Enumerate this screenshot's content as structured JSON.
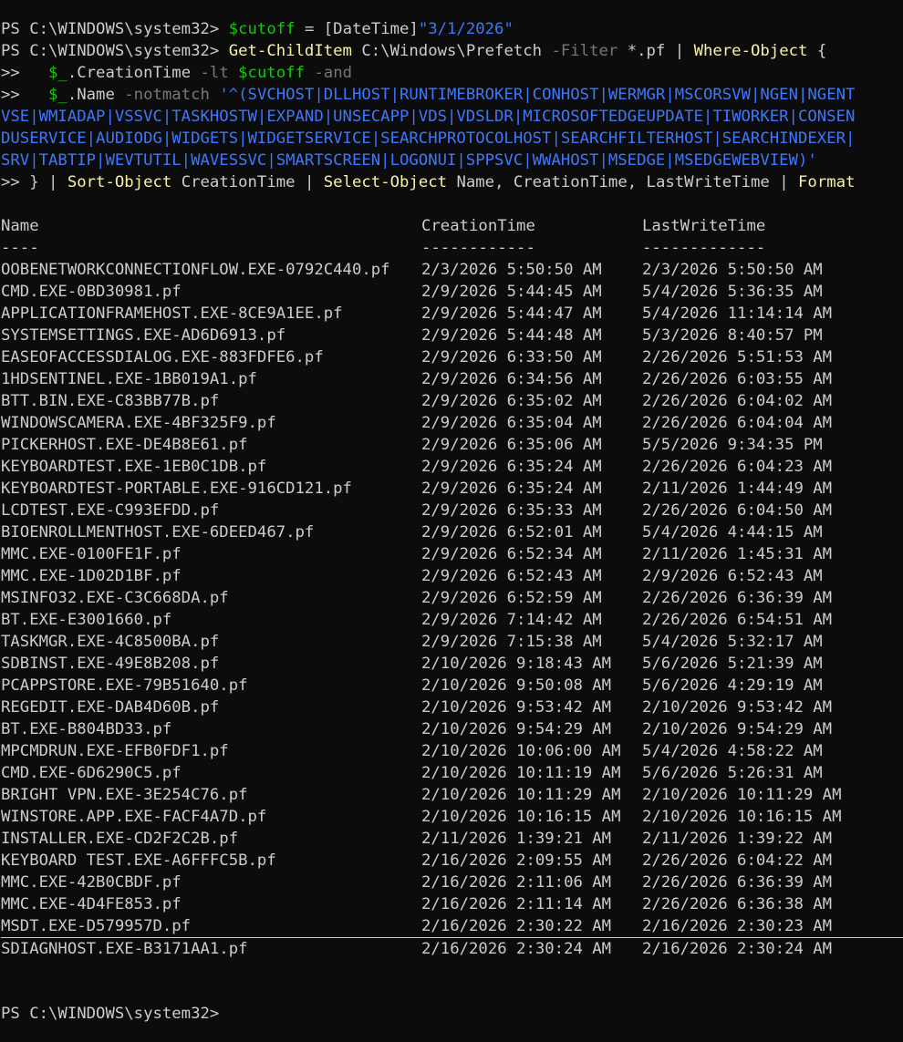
{
  "prompt": "PS C:\\WINDOWS\\system32>",
  "cont": ">>",
  "cmd1": {
    "var": "$cutoff",
    "eq": "=",
    "type": "[DateTime]",
    "value": "\"3/1/2026\""
  },
  "cmd2": {
    "cmdlet": "Get-ChildItem",
    "path": "C:\\Windows\\Prefetch",
    "param": "-Filter",
    "filter": "*.pf",
    "pipe": "|",
    "where": "Where-Object",
    "brace": "{"
  },
  "cmd3": {
    "var": "$_",
    "prop": ".CreationTime",
    "op": "-lt",
    "var2": "$cutoff",
    "and": "-and"
  },
  "cmd4": {
    "var": "$_",
    "prop": ".Name",
    "op": "-notmatch",
    "pattern": "'^(SVCHOST|DLLHOST|RUNTIMEBROKER|CONHOST|WERMGR|MSCORSVW|NGEN|NGENT"
  },
  "wrap1": "VSE|WMIADAP|VSSVC|TASKHOSTW|EXPAND|UNSECAPP|VDS|VDSLDR|MICROSOFTEDGEUPDATE|TIWORKER|CONSEN",
  "wrap2": "DUSERVICE|AUDIODG|WIDGETS|WIDGETSERVICE|SEARCHPROTOCOLHOST|SEARCHFILTERHOST|SEARCHINDEXER|",
  "wrap3": "SRV|TABTIP|WEVTUTIL|WAVESSVC|SMARTSCREEN|LOGONUI|SPPSVC|WWAHOST|MSEDGE|MSEDGEWEBVIEW)'",
  "cmd5": {
    "close": "}",
    "pipe": "|",
    "sort": "Sort-Object",
    "sortArg": "CreationTime",
    "select": "Select-Object",
    "selectArgs": "Name, CreationTime, LastWriteTime",
    "format": "Format"
  },
  "table": {
    "headers": [
      "Name",
      "CreationTime",
      "LastWriteTime"
    ],
    "underlines": [
      "----",
      "------------",
      "-------------"
    ],
    "rows": [
      [
        "OOBENETWORKCONNECTIONFLOW.EXE-0792C440.pf",
        "2/3/2026 5:50:50 AM",
        "2/3/2026 5:50:50 AM"
      ],
      [
        "CMD.EXE-0BD30981.pf",
        "2/9/2026 5:44:45 AM",
        "5/4/2026 5:36:35 AM"
      ],
      [
        "APPLICATIONFRAMEHOST.EXE-8CE9A1EE.pf",
        "2/9/2026 5:44:47 AM",
        "5/4/2026 11:14:14 AM"
      ],
      [
        "SYSTEMSETTINGS.EXE-AD6D6913.pf",
        "2/9/2026 5:44:48 AM",
        "5/3/2026 8:40:57 PM"
      ],
      [
        "EASEOFACCESSDIALOG.EXE-883FDFE6.pf",
        "2/9/2026 6:33:50 AM",
        "2/26/2026 5:51:53 AM"
      ],
      [
        "1HDSENTINEL.EXE-1BB019A1.pf",
        "2/9/2026 6:34:56 AM",
        "2/26/2026 6:03:55 AM"
      ],
      [
        "BTT.BIN.EXE-C83BB77B.pf",
        "2/9/2026 6:35:02 AM",
        "2/26/2026 6:04:02 AM"
      ],
      [
        "WINDOWSCAMERA.EXE-4BF325F9.pf",
        "2/9/2026 6:35:04 AM",
        "2/26/2026 6:04:04 AM"
      ],
      [
        "PICKERHOST.EXE-DE4B8E61.pf",
        "2/9/2026 6:35:06 AM",
        "5/5/2026 9:34:35 PM"
      ],
      [
        "KEYBOARDTEST.EXE-1EB0C1DB.pf",
        "2/9/2026 6:35:24 AM",
        "2/26/2026 6:04:23 AM"
      ],
      [
        "KEYBOARDTEST-PORTABLE.EXE-916CD121.pf",
        "2/9/2026 6:35:24 AM",
        "2/11/2026 1:44:49 AM"
      ],
      [
        "LCDTEST.EXE-C993EFDD.pf",
        "2/9/2026 6:35:33 AM",
        "2/26/2026 6:04:50 AM"
      ],
      [
        "BIOENROLLMENTHOST.EXE-6DEED467.pf",
        "2/9/2026 6:52:01 AM",
        "5/4/2026 4:44:15 AM"
      ],
      [
        "MMC.EXE-0100FE1F.pf",
        "2/9/2026 6:52:34 AM",
        "2/11/2026 1:45:31 AM"
      ],
      [
        "MMC.EXE-1D02D1BF.pf",
        "2/9/2026 6:52:43 AM",
        "2/9/2026 6:52:43 AM"
      ],
      [
        "MSINFO32.EXE-C3C668DA.pf",
        "2/9/2026 6:52:59 AM",
        "2/26/2026 6:36:39 AM"
      ],
      [
        "BT.EXE-E3001660.pf",
        "2/9/2026 7:14:42 AM",
        "2/26/2026 6:54:51 AM"
      ],
      [
        "TASKMGR.EXE-4C8500BA.pf",
        "2/9/2026 7:15:38 AM",
        "5/4/2026 5:32:17 AM"
      ],
      [
        "SDBINST.EXE-49E8B208.pf",
        "2/10/2026 9:18:43 AM",
        "5/6/2026 5:21:39 AM"
      ],
      [
        "PCAPPSTORE.EXE-79B51640.pf",
        "2/10/2026 9:50:08 AM",
        "5/6/2026 4:29:19 AM"
      ],
      [
        "REGEDIT.EXE-DAB4D60B.pf",
        "2/10/2026 9:53:42 AM",
        "2/10/2026 9:53:42 AM"
      ],
      [
        "BT.EXE-B804BD33.pf",
        "2/10/2026 9:54:29 AM",
        "2/10/2026 9:54:29 AM"
      ],
      [
        "MPCMDRUN.EXE-EFB0FDF1.pf",
        "2/10/2026 10:06:00 AM",
        "5/4/2026 4:58:22 AM"
      ],
      [
        "CMD.EXE-6D6290C5.pf",
        "2/10/2026 10:11:19 AM",
        "5/6/2026 5:26:31 AM"
      ],
      [
        "BRIGHT VPN.EXE-3E254C76.pf",
        "2/10/2026 10:11:29 AM",
        "2/10/2026 10:11:29 AM"
      ],
      [
        "WINSTORE.APP.EXE-FACF4A7D.pf",
        "2/10/2026 10:16:15 AM",
        "2/10/2026 10:16:15 AM"
      ],
      [
        "INSTALLER.EXE-CD2F2C2B.pf",
        "2/11/2026 1:39:21 AM",
        "2/11/2026 1:39:22 AM"
      ],
      [
        "KEYBOARD TEST.EXE-A6FFFC5B.pf",
        "2/16/2026 2:09:55 AM",
        "2/26/2026 6:04:22 AM"
      ],
      [
        "MMC.EXE-42B0CBDF.pf",
        "2/16/2026 2:11:06 AM",
        "2/26/2026 6:36:39 AM"
      ],
      [
        "MMC.EXE-4D4FE853.pf",
        "2/16/2026 2:11:14 AM",
        "2/26/2026 6:36:38 AM"
      ],
      [
        "MSDT.EXE-D579957D.pf",
        "2/16/2026 2:30:22 AM",
        "2/16/2026 2:30:23 AM"
      ],
      [
        "SDIAGNHOST.EXE-B3171AA1.pf",
        "2/16/2026 2:30:24 AM",
        "2/16/2026 2:30:24 AM"
      ]
    ]
  },
  "colors": {
    "background": "#0c0c0c",
    "text": "#cccccc",
    "cmdlet": "#f9f1a5",
    "variable": "#16c60c",
    "parameter": "#767676",
    "string": "#3b78ff"
  }
}
